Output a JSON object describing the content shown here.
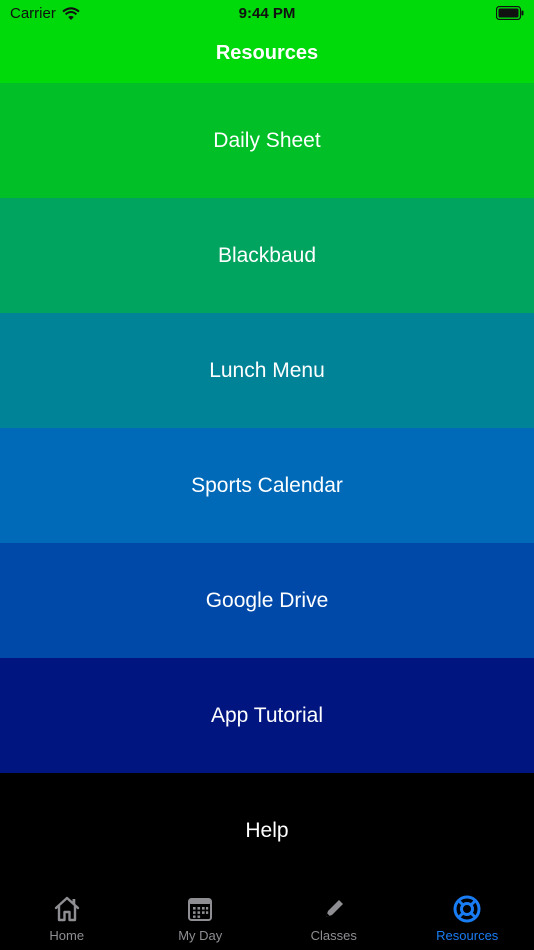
{
  "status_bar": {
    "carrier": "Carrier",
    "time": "9:44 PM"
  },
  "nav": {
    "title": "Resources"
  },
  "menu": {
    "items": [
      {
        "label": "Daily Sheet",
        "color": "#00bf27"
      },
      {
        "label": "Blackbaud",
        "color": "#00a45e"
      },
      {
        "label": "Lunch Menu",
        "color": "#008396"
      },
      {
        "label": "Sports Calendar",
        "color": "#006ab9"
      },
      {
        "label": "Google Drive",
        "color": "#0049a8"
      },
      {
        "label": "App Tutorial",
        "color": "#001580"
      },
      {
        "label": "Help",
        "color": "#000000"
      }
    ]
  },
  "tabbar": {
    "items": [
      {
        "label": "Home",
        "icon": "house-icon"
      },
      {
        "label": "My Day",
        "icon": "calendar-icon"
      },
      {
        "label": "Classes",
        "icon": "pencil-icon"
      },
      {
        "label": "Resources",
        "icon": "lifebuoy-icon",
        "active": true
      }
    ],
    "active_color": "#1a7cf2",
    "inactive_color": "#8e8e93"
  }
}
